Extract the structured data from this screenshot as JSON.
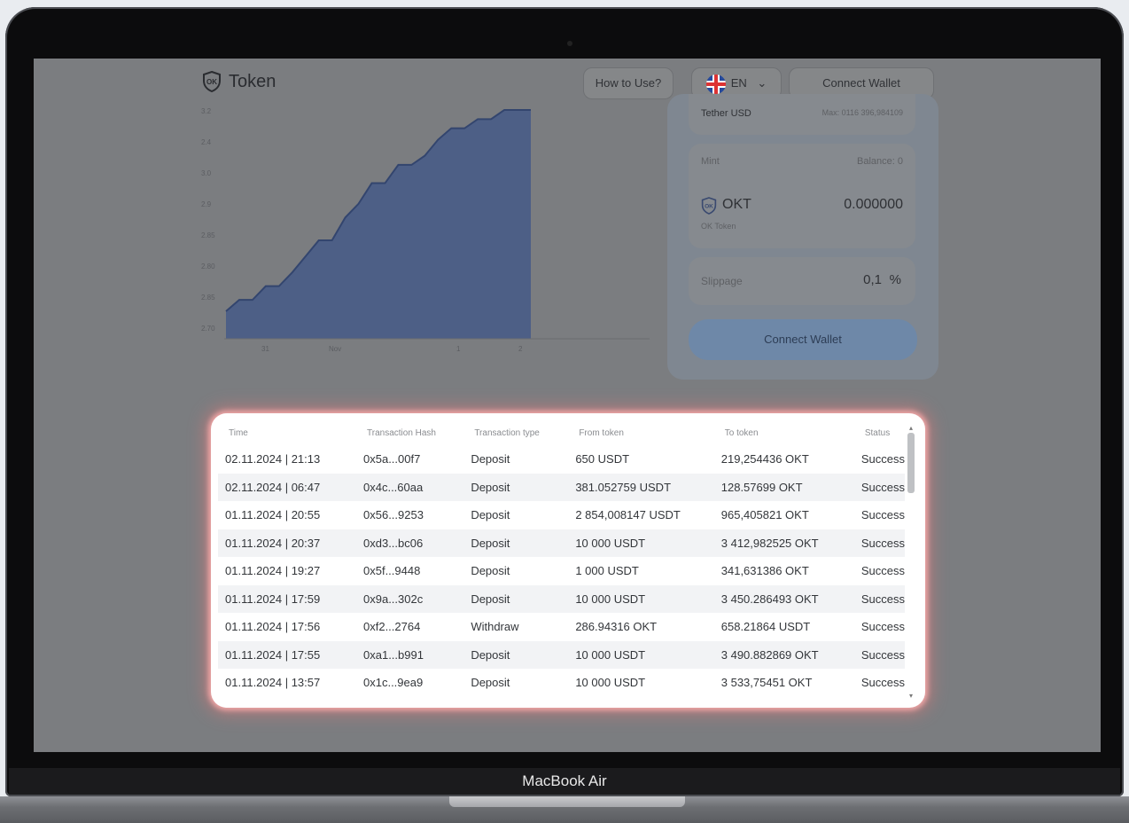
{
  "device_label": "MacBook Air",
  "header": {
    "brand": "Token",
    "how_to_use": "How to Use?",
    "language": "EN",
    "connect_wallet": "Connect Wallet"
  },
  "chart_data": {
    "type": "area",
    "y_tick_labels": [
      "3.2",
      "2.4",
      "3.0",
      "2.9",
      "2.85",
      "2.80",
      "2.85",
      "2.70"
    ],
    "x_tick_labels": [
      "31",
      "Nov",
      "1",
      "2"
    ],
    "y": [
      0.12,
      0.17,
      0.17,
      0.23,
      0.23,
      0.29,
      0.36,
      0.43,
      0.43,
      0.53,
      0.59,
      0.68,
      0.68,
      0.76,
      0.76,
      0.8,
      0.87,
      0.92,
      0.92,
      0.96,
      0.96,
      1.0,
      1.0,
      1.0
    ],
    "color": "#4a6bbf"
  },
  "swap": {
    "token_from_name": "Tether USD",
    "token_from_max": "Max: 0116 396,984109",
    "mint_label": "Mint",
    "balance": "Balance: 0",
    "token_to_symbol": "OKT",
    "token_to_amount": "0.000000",
    "token_to_name": "OK Token",
    "slippage_label": "Slippage",
    "slippage_value": "0,1",
    "slippage_unit": "%",
    "connect_wallet": "Connect Wallet"
  },
  "table": {
    "headers": [
      "Time",
      "Transaction Hash",
      "Transaction type",
      "From token",
      "To token",
      "Status"
    ],
    "rows": [
      [
        "02.11.2024 | 21:13",
        "0x5a...00f7",
        "Deposit",
        "650 USDT",
        "219,254436 OKT",
        "Success"
      ],
      [
        "02.11.2024 | 06:47",
        "0x4c...60aa",
        "Deposit",
        "381.052759 USDT",
        "128.57699 OKT",
        "Success"
      ],
      [
        "01.11.2024 | 20:55",
        "0x56...9253",
        "Deposit",
        "2 854,008147 USDT",
        "965,405821 OKT",
        "Success"
      ],
      [
        "01.11.2024 | 20:37",
        "0xd3...bc06",
        "Deposit",
        "10 000 USDT",
        "3 412,982525 OKT",
        "Success"
      ],
      [
        "01.11.2024 | 19:27",
        "0x5f...9448",
        "Deposit",
        "1 000 USDT",
        "341,631386 OKT",
        "Success"
      ],
      [
        "01.11.2024 | 17:59",
        "0x9a...302c",
        "Deposit",
        "10 000 USDT",
        "3 450.286493 OKT",
        "Success"
      ],
      [
        "01.11.2024 | 17:56",
        "0xf2...2764",
        "Withdraw",
        "286.94316 OKT",
        "658.21864 USDT",
        "Success"
      ],
      [
        "01.11.2024 | 17:55",
        "0xa1...b991",
        "Deposit",
        "10 000 USDT",
        "3 490.882869 OKT",
        "Success"
      ],
      [
        "01.11.2024 | 13:57",
        "0x1c...9ea9",
        "Deposit",
        "10 000 USDT",
        "3 533,75451 OKT",
        "Success"
      ]
    ]
  },
  "colors": {
    "chart_fill": "#4a6bbf",
    "highlight_glow": "#f0a7a7",
    "connect_button": "#8fb3e6"
  }
}
